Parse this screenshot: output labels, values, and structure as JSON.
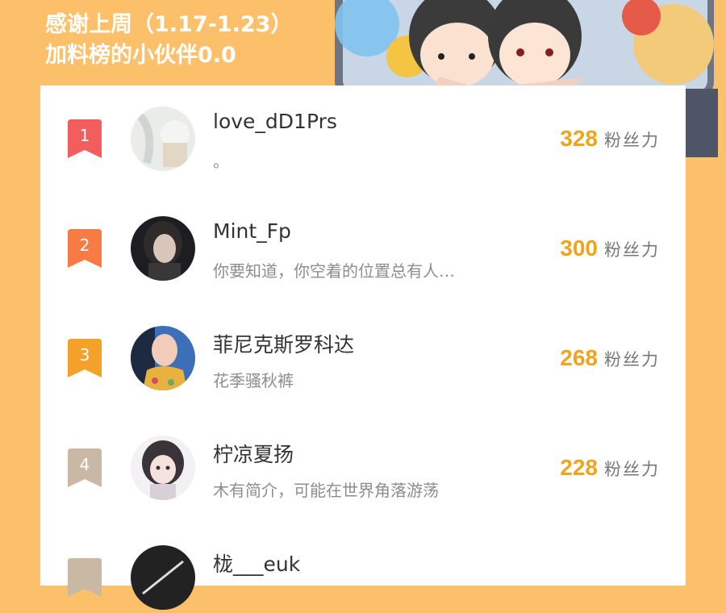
{
  "header": {
    "title_line1": "感谢上周（1.17-1.23）",
    "title_line2": "加料榜的小伙伴0.0"
  },
  "ranking": {
    "unit_label": "粉丝力",
    "items": [
      {
        "rank": "1",
        "username": "love_dD1Prs",
        "bio": "。",
        "score": "328",
        "badge_color": "#f25e5e"
      },
      {
        "rank": "2",
        "username": "Mint_Fp",
        "bio": "你要知道，你空着的位置总有人…",
        "score": "300",
        "badge_color": "#f77b45"
      },
      {
        "rank": "3",
        "username": "菲尼克斯罗科达",
        "bio": "花季骚秋裤",
        "score": "268",
        "badge_color": "#f4a12a"
      },
      {
        "rank": "4",
        "username": "柠凉夏扬",
        "bio": "木有简介，可能在世界角落游荡",
        "score": "228",
        "badge_color": "#c9b8a3"
      },
      {
        "rank": "",
        "username": "栊___euk",
        "bio": "",
        "score": "",
        "badge_color": "#c9b8a3"
      }
    ]
  }
}
